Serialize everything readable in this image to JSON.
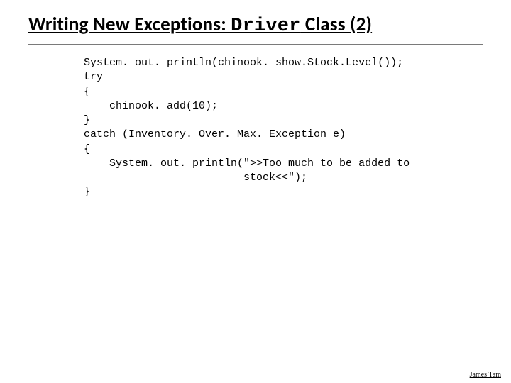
{
  "title": {
    "pre": "Writing New Exceptions: ",
    "mono": "Driver",
    "post": " Class (2)"
  },
  "code": "System. out. println(chinook. show.Stock.Level());\ntry\n{\n    chinook. add(10);\n}\ncatch (Inventory. Over. Max. Exception e)\n{\n    System. out. println(\">>Too much to be added to\n                         stock<<\");\n}",
  "footer": "James Tam"
}
